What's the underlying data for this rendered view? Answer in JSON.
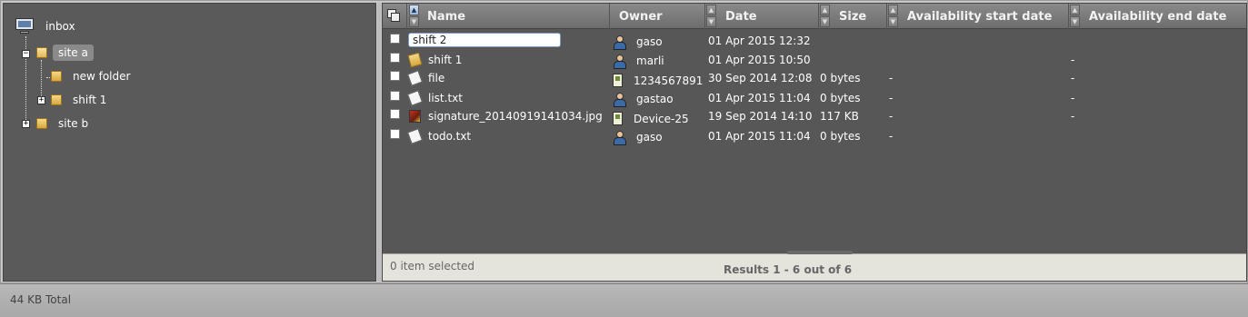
{
  "tree": {
    "root_label": "inbox",
    "nodes": [
      {
        "label": "site a",
        "selected": true
      },
      {
        "label": "new folder"
      },
      {
        "label": "shift 1"
      },
      {
        "label": "site b"
      }
    ]
  },
  "grid": {
    "columns": {
      "name": "Name",
      "owner": "Owner",
      "date": "Date",
      "size": "Size",
      "availability_start": "Availability start date",
      "availability_end": "Availability end date"
    },
    "rows": [
      {
        "name": "shift 2",
        "type": "folder",
        "editing": true,
        "owner": "gaso",
        "owner_type": "user",
        "date": "01 Apr 2015 12:32",
        "size": "",
        "avail_start": "",
        "avail_end": ""
      },
      {
        "name": "shift 1",
        "type": "folder",
        "owner": "marli",
        "owner_type": "user",
        "date": "01 Apr 2015 10:50",
        "size": "",
        "avail_start": "",
        "avail_end": "-"
      },
      {
        "name": "file",
        "type": "doc",
        "owner": "1234567891",
        "owner_type": "device",
        "date": "30 Sep 2014 12:08",
        "size": "0 bytes",
        "avail_start": "-",
        "avail_end": "-"
      },
      {
        "name": "list.txt",
        "type": "doc",
        "owner": "gastao",
        "owner_type": "user",
        "date": "01 Apr 2015 11:04",
        "size": "0 bytes",
        "avail_start": "-",
        "avail_end": "-"
      },
      {
        "name": "signature_20140919141034.jpg",
        "type": "image",
        "owner": "Device-25",
        "owner_type": "device",
        "date": "19 Sep 2014 14:10",
        "size": "117 KB",
        "avail_start": "-",
        "avail_end": "-"
      },
      {
        "name": "todo.txt",
        "type": "doc",
        "owner": "gaso",
        "owner_type": "user",
        "date": "01 Apr 2015 11:04",
        "size": "0 bytes",
        "avail_start": "-",
        "avail_end": ""
      }
    ],
    "footer": {
      "selection": "0 item selected",
      "results": "Results 1 - 6 out of 6"
    }
  },
  "status_bar": {
    "total": "44 KB Total"
  },
  "colors": {
    "panel_bg": "#575757",
    "header_bg": "#7a7a7a",
    "footer_bg": "#e4e4dc",
    "selection_bg": "#8a8a8a"
  }
}
